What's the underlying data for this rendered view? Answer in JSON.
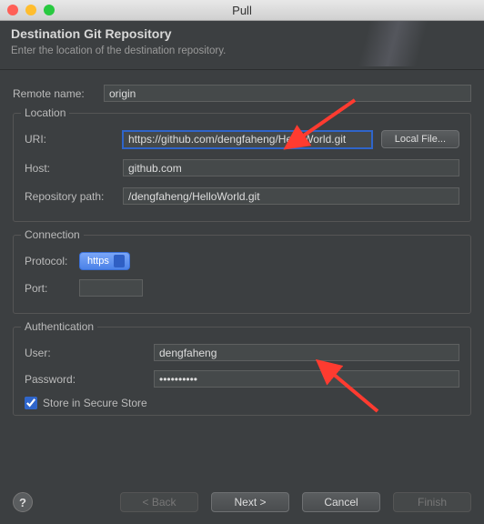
{
  "window": {
    "title": "Pull"
  },
  "header": {
    "title": "Destination Git Repository",
    "subtitle": "Enter the location of the destination repository."
  },
  "remote": {
    "label": "Remote name:",
    "value": "origin"
  },
  "location": {
    "legend": "Location",
    "uri_label": "URI:",
    "uri_value": "https://github.com/dengfaheng/HelloWorld.git",
    "local_file_btn": "Local File...",
    "host_label": "Host:",
    "host_value": "github.com",
    "repopath_label": "Repository path:",
    "repopath_value": "/dengfaheng/HelloWorld.git"
  },
  "connection": {
    "legend": "Connection",
    "protocol_label": "Protocol:",
    "protocol_value": "https",
    "port_label": "Port:",
    "port_value": ""
  },
  "auth": {
    "legend": "Authentication",
    "user_label": "User:",
    "user_value": "dengfaheng",
    "password_label": "Password:",
    "password_value": "••••••••••",
    "store_label": "Store in Secure Store",
    "store_checked": true
  },
  "buttons": {
    "back": "< Back",
    "next": "Next >",
    "cancel": "Cancel",
    "finish": "Finish"
  }
}
